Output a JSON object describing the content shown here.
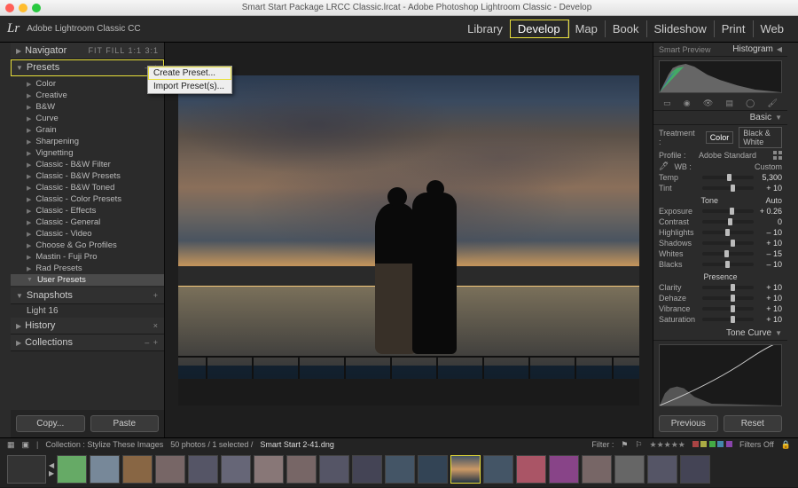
{
  "window": {
    "title": "Smart Start Package LRCC Classic.lrcat - Adobe Photoshop Lightroom Classic - Develop"
  },
  "app": {
    "logo": "Lr",
    "name": "Adobe Lightroom Classic CC"
  },
  "modules": [
    "Library",
    "Develop",
    "Map",
    "Book",
    "Slideshow",
    "Print",
    "Web"
  ],
  "module_active": "Develop",
  "left": {
    "navigator": {
      "title": "Navigator",
      "modes": "FIT   FILL   1:1   3:1"
    },
    "presets": {
      "title": "Presets",
      "buttons": "–  +",
      "folders": [
        "Color",
        "Creative",
        "B&W",
        "Curve",
        "Grain",
        "Sharpening",
        "Vignetting",
        "Classic - B&W Filter",
        "Classic - B&W Presets",
        "Classic - B&W Toned",
        "Classic - Color Presets",
        "Classic - Effects",
        "Classic - General",
        "Classic - Video",
        "Choose & Go Profiles",
        "Mastin - Fuji Pro",
        "Rad Presets",
        "User Presets"
      ]
    },
    "context": {
      "create": "Create Preset...",
      "import": "Import Preset(s)..."
    },
    "snapshots": {
      "title": "Snapshots",
      "buttons": "+",
      "item": "Light 16"
    },
    "history": {
      "title": "History",
      "tail": "×"
    },
    "collections": {
      "title": "Collections",
      "tail": "–  +"
    },
    "copy": "Copy...",
    "paste": "Paste"
  },
  "right": {
    "smart_preview": "Smart Preview",
    "histogram": "Histogram",
    "basic": "Basic",
    "treatment_label": "Treatment :",
    "treat_color": "Color",
    "treat_bw": "Black & White",
    "profile_label": "Profile :",
    "profile_value": "Adobe Standard",
    "wb_label": "WB :",
    "wb_value": "Custom",
    "sliders": {
      "temp": {
        "label": "Temp",
        "value": "5,300",
        "pos": 48
      },
      "tint": {
        "label": "Tint",
        "value": "+ 10",
        "pos": 55
      },
      "tone_title": "Tone",
      "tone_auto": "Auto",
      "exposure": {
        "label": "Exposure",
        "value": "+ 0.26",
        "pos": 54
      },
      "contrast": {
        "label": "Contrast",
        "value": "0",
        "pos": 50
      },
      "highlights": {
        "label": "Highlights",
        "value": "– 10",
        "pos": 45
      },
      "shadows": {
        "label": "Shadows",
        "value": "+ 10",
        "pos": 55
      },
      "whites": {
        "label": "Whites",
        "value": "– 15",
        "pos": 43
      },
      "blacks": {
        "label": "Blacks",
        "value": "– 10",
        "pos": 45
      },
      "presence_title": "Presence",
      "clarity": {
        "label": "Clarity",
        "value": "+ 10",
        "pos": 55
      },
      "dehaze": {
        "label": "Dehaze",
        "value": "+ 10",
        "pos": 55
      },
      "vibrance": {
        "label": "Vibrance",
        "value": "+ 10",
        "pos": 55
      },
      "saturation": {
        "label": "Saturation",
        "value": "+ 10",
        "pos": 55
      }
    },
    "tone_curve": "Tone Curve",
    "previous": "Previous",
    "reset": "Reset"
  },
  "footer": {
    "collection_label": "Collection : Stylize These Images",
    "count": "50 photos / 1 selected /",
    "filename": "Smart Start 2-41.dng",
    "filter_label": "Filter :",
    "filters_off": "Filters Off"
  }
}
